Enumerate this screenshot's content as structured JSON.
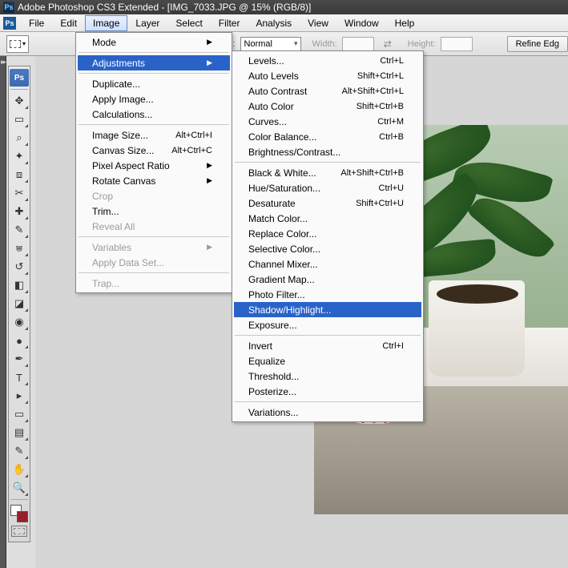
{
  "title": "Adobe Photoshop CS3 Extended - [IMG_7033.JPG @ 15% (RGB/8)]",
  "logo_text": "Ps",
  "menubar": [
    "File",
    "Edit",
    "Image",
    "Layer",
    "Select",
    "Filter",
    "Analysis",
    "View",
    "Window",
    "Help"
  ],
  "menubar_open_index": 2,
  "options": {
    "style_label": "Style:",
    "style_value": "Normal",
    "width_label": "Width:",
    "height_label": "Height:",
    "refine_label": "Refine Edg"
  },
  "image_menu": [
    {
      "label": "Mode",
      "sub": true
    },
    {
      "sep": true
    },
    {
      "label": "Adjustments",
      "sub": true,
      "hl": true
    },
    {
      "sep": true
    },
    {
      "label": "Duplicate..."
    },
    {
      "label": "Apply Image..."
    },
    {
      "label": "Calculations..."
    },
    {
      "sep": true
    },
    {
      "label": "Image Size...",
      "accel": "Alt+Ctrl+I"
    },
    {
      "label": "Canvas Size...",
      "accel": "Alt+Ctrl+C"
    },
    {
      "label": "Pixel Aspect Ratio",
      "sub": true
    },
    {
      "label": "Rotate Canvas",
      "sub": true
    },
    {
      "label": "Crop",
      "disabled": true
    },
    {
      "label": "Trim..."
    },
    {
      "label": "Reveal All",
      "disabled": true
    },
    {
      "sep": true
    },
    {
      "label": "Variables",
      "sub": true,
      "disabled": true
    },
    {
      "label": "Apply Data Set...",
      "disabled": true
    },
    {
      "sep": true
    },
    {
      "label": "Trap...",
      "disabled": true
    }
  ],
  "adjust_menu": [
    {
      "label": "Levels...",
      "accel": "Ctrl+L"
    },
    {
      "label": "Auto Levels",
      "accel": "Shift+Ctrl+L"
    },
    {
      "label": "Auto Contrast",
      "accel": "Alt+Shift+Ctrl+L"
    },
    {
      "label": "Auto Color",
      "accel": "Shift+Ctrl+B"
    },
    {
      "label": "Curves...",
      "accel": "Ctrl+M"
    },
    {
      "label": "Color Balance...",
      "accel": "Ctrl+B"
    },
    {
      "label": "Brightness/Contrast..."
    },
    {
      "sep": true
    },
    {
      "label": "Black & White...",
      "accel": "Alt+Shift+Ctrl+B"
    },
    {
      "label": "Hue/Saturation...",
      "accel": "Ctrl+U"
    },
    {
      "label": "Desaturate",
      "accel": "Shift+Ctrl+U"
    },
    {
      "label": "Match Color..."
    },
    {
      "label": "Replace Color..."
    },
    {
      "label": "Selective Color..."
    },
    {
      "label": "Channel Mixer..."
    },
    {
      "label": "Gradient Map..."
    },
    {
      "label": "Photo Filter..."
    },
    {
      "label": "Shadow/Highlight...",
      "hl": true
    },
    {
      "label": "Exposure..."
    },
    {
      "sep": true
    },
    {
      "label": "Invert",
      "accel": "Ctrl+I"
    },
    {
      "label": "Equalize"
    },
    {
      "label": "Threshold..."
    },
    {
      "label": "Posterize..."
    },
    {
      "sep": true
    },
    {
      "label": "Variations..."
    }
  ],
  "tools": [
    {
      "name": "move-tool",
      "glyph": "✥"
    },
    {
      "name": "marquee-tool",
      "glyph": "▭",
      "active": true
    },
    {
      "name": "lasso-tool",
      "glyph": "⌕"
    },
    {
      "name": "magic-wand-tool",
      "glyph": "✦"
    },
    {
      "name": "crop-tool",
      "glyph": "⧈"
    },
    {
      "name": "slice-tool",
      "glyph": "✂"
    },
    {
      "name": "healing-brush-tool",
      "glyph": "✚"
    },
    {
      "name": "brush-tool",
      "glyph": "✎"
    },
    {
      "name": "clone-stamp-tool",
      "glyph": "⩐"
    },
    {
      "name": "history-brush-tool",
      "glyph": "↺"
    },
    {
      "name": "eraser-tool",
      "glyph": "◧"
    },
    {
      "name": "gradient-tool",
      "glyph": "◪"
    },
    {
      "name": "blur-tool",
      "glyph": "◉"
    },
    {
      "name": "dodge-tool",
      "glyph": "●"
    },
    {
      "name": "pen-tool",
      "glyph": "✒"
    },
    {
      "name": "type-tool",
      "glyph": "T"
    },
    {
      "name": "path-selection-tool",
      "glyph": "▸"
    },
    {
      "name": "shape-tool",
      "glyph": "▭"
    },
    {
      "name": "notes-tool",
      "glyph": "▤"
    },
    {
      "name": "eyedropper-tool",
      "glyph": "✎"
    },
    {
      "name": "hand-tool",
      "glyph": "✋"
    },
    {
      "name": "zoom-tool",
      "glyph": "🔍"
    }
  ]
}
